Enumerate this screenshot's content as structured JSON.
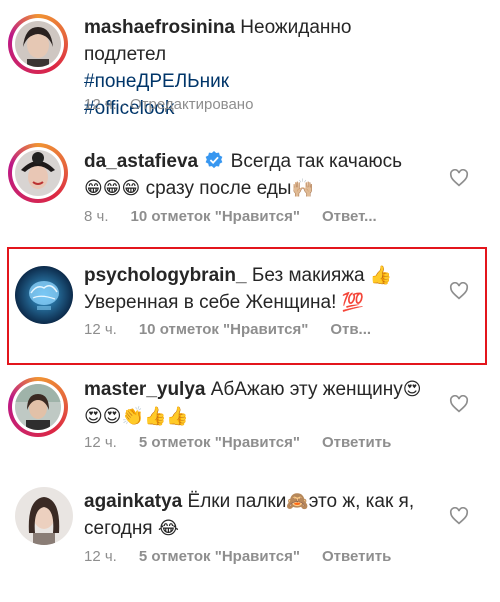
{
  "caption": {
    "username": "mashaefrosinina",
    "text": "Неожиданно подлетел",
    "hashtags": [
      "#понеДРЕЛЬник",
      "#officelook"
    ],
    "time": "12 ч.",
    "edited": "· Отредактировано"
  },
  "comments": [
    {
      "username": "da_astafieva",
      "verified": true,
      "line1": "Всегда так качаюсь",
      "line2_emoji": "😁😁😁",
      "line2_text": "сразу после еды",
      "line2_tail": "🙌🏼",
      "time": "8 ч.",
      "likes": "10 отметок \"Нравится\"",
      "reply": "Ответ..."
    },
    {
      "username": "psychologybrain_",
      "line1": "Без макияжа",
      "line1_tail": "👍",
      "line2_text": "Уверенная в себе Женщина!",
      "line2_tail": "💯",
      "time": "12 ч.",
      "likes": "10 отметок \"Нравится\"",
      "reply": "Отв..."
    },
    {
      "username": "master_yulya",
      "line1": "АбАжаю эту женщину",
      "line1_tail": "😍",
      "line2_emoji": "😍😍👏👍👍",
      "time": "12 ч.",
      "likes": "5 отметок \"Нравится\"",
      "reply": "Ответить"
    },
    {
      "username": "againkatya",
      "line1": "Ёлки палки",
      "line1_tail": "🙈",
      "line1_after": "это ж, как я,",
      "line2_text": "сегодня",
      "line2_tail": "😂",
      "time": "12 ч.",
      "likes": "5 отметок \"Нравится\"",
      "reply": "Ответить"
    }
  ],
  "colors": {
    "highlight_border": "#e3151c",
    "hashtag": "#003569",
    "meta": "#8e8e8e",
    "verified": "#3897f0"
  }
}
